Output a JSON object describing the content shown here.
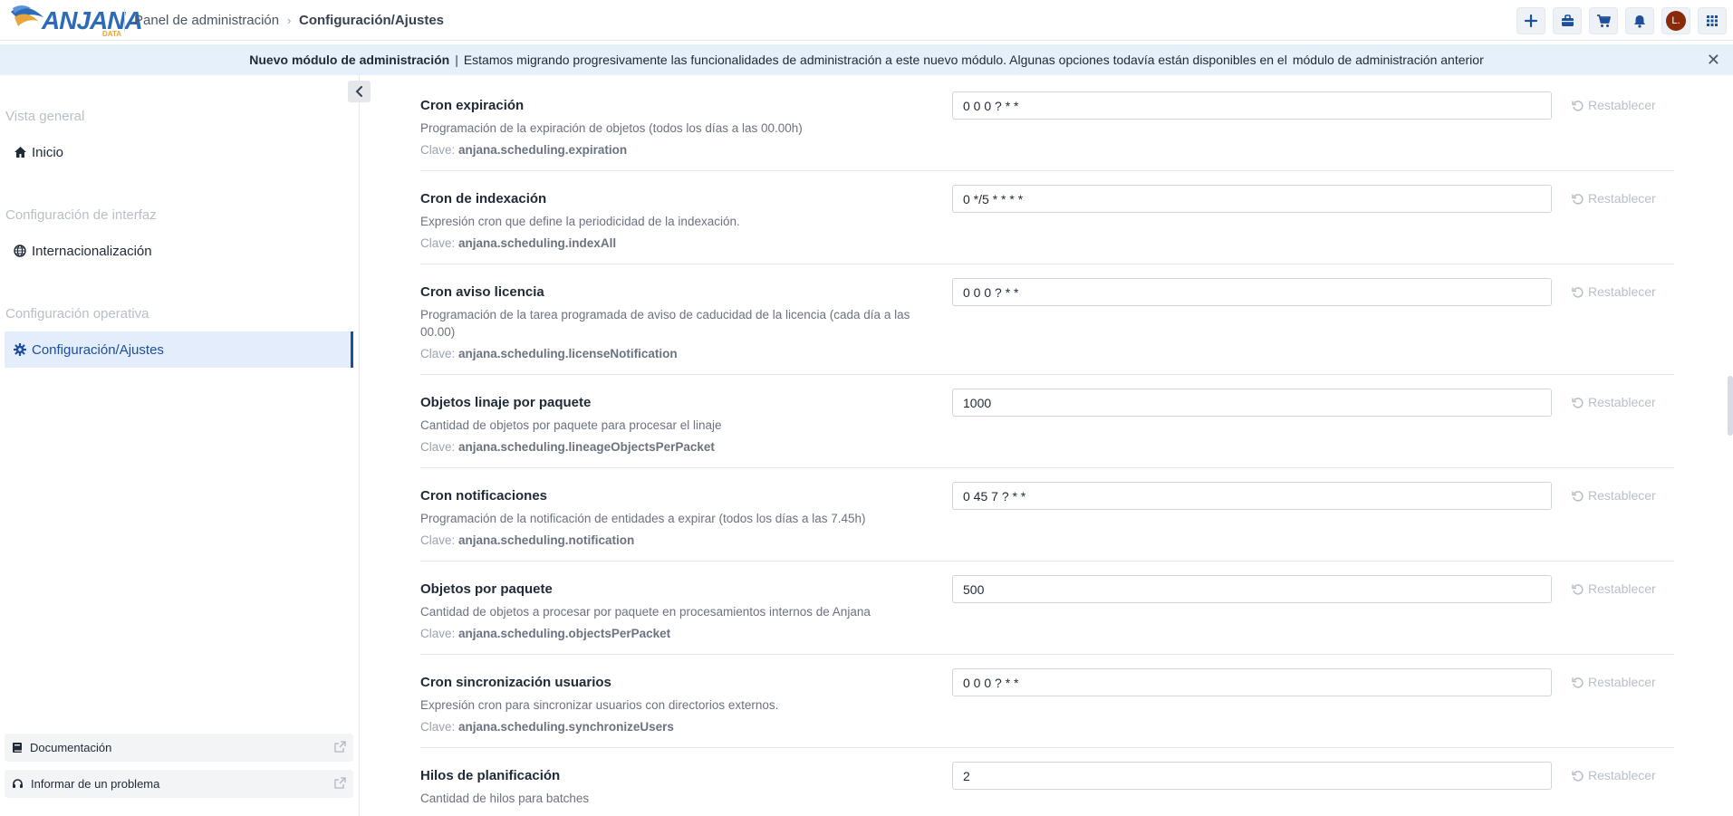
{
  "header": {
    "logo_text": "ANJANA",
    "logo_sub": "DATA",
    "breadcrumb": [
      "Panel de administración",
      "Configuración/Ajustes"
    ],
    "buttons": [
      "plus-icon",
      "briefcase-icon",
      "cart-icon",
      "bell-icon",
      "grid-icon"
    ],
    "avatar_initial": "L."
  },
  "banner": {
    "title": "Nuevo módulo de administración",
    "pipe": "|",
    "text": "Estamos migrando progresivamente las funcionalidades de administración a este nuevo módulo. Algunas opciones todavía están disponibles en el",
    "link": "módulo de administración anterior"
  },
  "sidebar": {
    "sections": [
      {
        "title": "Vista general",
        "items": [
          {
            "label": "Inicio",
            "icon": "home-icon"
          }
        ]
      },
      {
        "title": "Configuración de interfaz",
        "items": [
          {
            "label": "Internacionalización",
            "icon": "globe-icon"
          }
        ]
      },
      {
        "title": "Configuración operativa",
        "items": [
          {
            "label": "Configuración/Ajustes",
            "icon": "gear-icon",
            "active": true
          }
        ]
      }
    ],
    "footer": [
      {
        "label": "Documentación",
        "icon": "book-icon"
      },
      {
        "label": "Informar de un problema",
        "icon": "headset-icon"
      }
    ]
  },
  "settings": {
    "key_prefix": "Clave:",
    "reset_label": "Restablecer",
    "items": [
      {
        "title": "Cron expiración",
        "desc": "Programación de la expiración de objetos (todos los días a las 00.00h)",
        "key": "anjana.scheduling.expiration",
        "value": "0 0 0 ? * *"
      },
      {
        "title": "Cron de indexación",
        "desc": "Expresión cron que define la periodicidad de la indexación.",
        "key": "anjana.scheduling.indexAll",
        "value": "0 */5 * * * *"
      },
      {
        "title": "Cron aviso licencia",
        "desc": "Programación de la tarea programada de aviso de caducidad de la licencia (cada día a las 00.00)",
        "key": "anjana.scheduling.licenseNotification",
        "value": "0 0 0 ? * *"
      },
      {
        "title": "Objetos linaje por paquete",
        "desc": "Cantidad de objetos por paquete para procesar el linaje",
        "key": "anjana.scheduling.lineageObjectsPerPacket",
        "value": "1000"
      },
      {
        "title": "Cron notificaciones",
        "desc": "Programación de la notificación de entidades a expirar (todos los días a las 7.45h)",
        "key": "anjana.scheduling.notification",
        "value": "0 45 7 ? * *"
      },
      {
        "title": "Objetos por paquete",
        "desc": "Cantidad de objetos a procesar por paquete en procesamientos internos de Anjana",
        "key": "anjana.scheduling.objectsPerPacket",
        "value": "500"
      },
      {
        "title": "Cron sincronización usuarios",
        "desc": "Expresión cron para sincronizar usuarios con directorios externos.",
        "key": "anjana.scheduling.synchronizeUsers",
        "value": "0 0 0 ? * *"
      },
      {
        "title": "Hilos de planificación",
        "desc": "Cantidad de hilos para batches",
        "key": "",
        "value": "2"
      }
    ]
  }
}
